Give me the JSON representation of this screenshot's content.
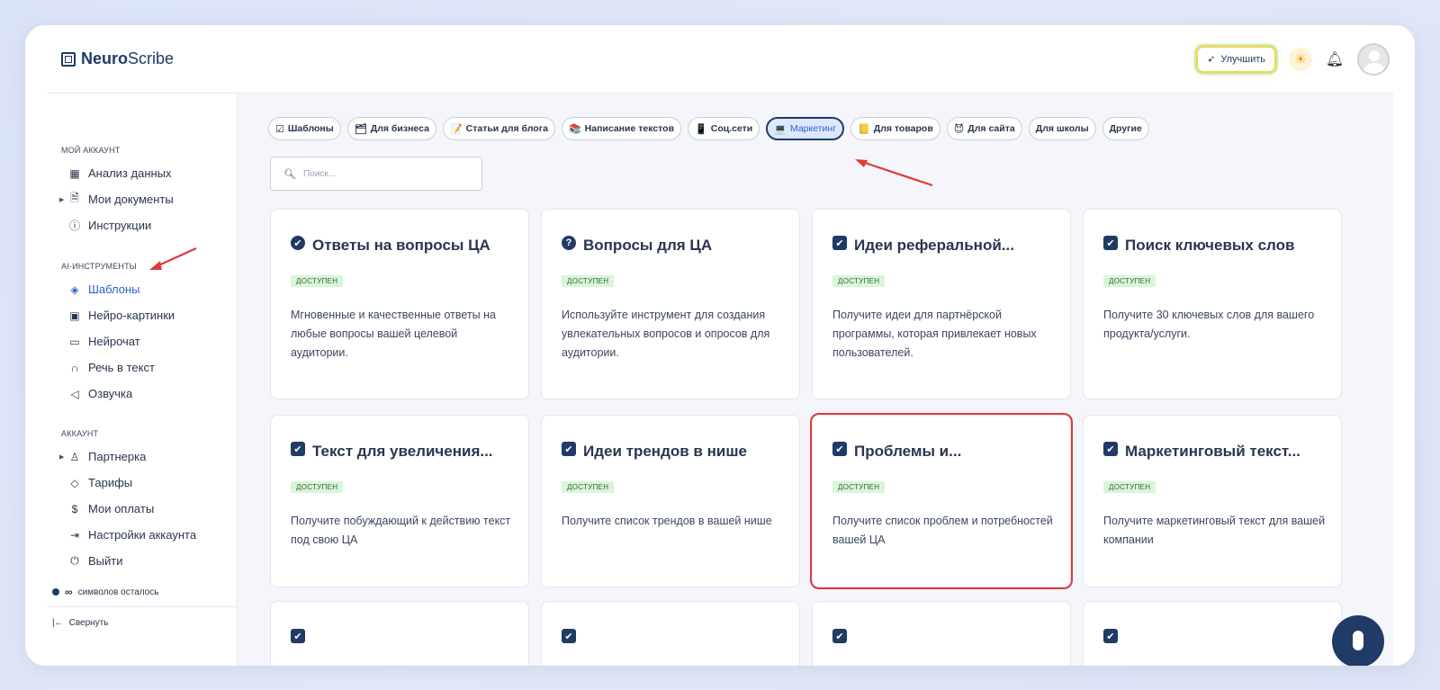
{
  "app": {
    "logo_bold": "Neuro",
    "logo_rest": "Scribe"
  },
  "header": {
    "upgrade_label": "Улучшить"
  },
  "sidebar": {
    "sections": [
      {
        "title": "МОЙ АККАУНТ",
        "items": [
          {
            "label": "Анализ данных",
            "icon": "grid-icon"
          },
          {
            "label": "Мои документы",
            "icon": "document-icon",
            "caret": true
          },
          {
            "label": "Инструкции",
            "icon": "help-circle-icon"
          }
        ]
      },
      {
        "title": "AI-ИНСТРУМЕНТЫ",
        "items": [
          {
            "label": "Шаблоны",
            "icon": "layers-icon",
            "active": true
          },
          {
            "label": "Нейро-картинки",
            "icon": "image-icon"
          },
          {
            "label": "Нейрочат",
            "icon": "chat-icon"
          },
          {
            "label": "Речь в текст",
            "icon": "headphones-icon"
          },
          {
            "label": "Озвучка",
            "icon": "speaker-icon"
          }
        ]
      },
      {
        "title": "АККАУНТ",
        "items": [
          {
            "label": "Партнерка",
            "icon": "users-icon",
            "caret": true
          },
          {
            "label": "Тарифы",
            "icon": "tag-icon"
          },
          {
            "label": "Мои оплаты",
            "icon": "dollar-icon"
          },
          {
            "label": "Настройки аккаунта",
            "icon": "login-icon"
          },
          {
            "label": "Выйти",
            "icon": "power-icon"
          }
        ]
      }
    ],
    "credits_value": "∞",
    "credits_label": "символов осталось",
    "collapse_label": "Свернуть"
  },
  "filters": [
    {
      "label": "Шаблоны",
      "icon": "☑"
    },
    {
      "label": "Для бизнеса",
      "icon": "🗂"
    },
    {
      "label": "Статьи для блога",
      "icon": "📝"
    },
    {
      "label": "Написание текстов",
      "icon": "📚"
    },
    {
      "label": "Соц.сети",
      "icon": "📱"
    },
    {
      "label": "Маркетинг",
      "icon": "💻",
      "active": true
    },
    {
      "label": "Для товаров",
      "icon": "📒"
    },
    {
      "label": "Для сайта",
      "icon": "😈"
    },
    {
      "label": "Для школы",
      "icon": ""
    },
    {
      "label": "Другие",
      "icon": ""
    }
  ],
  "search": {
    "placeholder": "Поиск..."
  },
  "cards": [
    {
      "title": "Ответы на вопросы ЦА",
      "badge": "ДОСТУПЕН",
      "desc": "Мгновенные и качественные ответы на любые вопросы вашей целевой аудитории.",
      "icon": "✔",
      "round": true
    },
    {
      "title": "Вопросы для ЦА",
      "badge": "ДОСТУПЕН",
      "desc": "Используйте инструмент для создания увлекательных вопросов и опросов для аудитории.",
      "icon": "?",
      "round": true
    },
    {
      "title": "Идеи реферальной...",
      "badge": "ДОСТУПЕН",
      "desc": "Получите идеи для партнёрской программы, которая привлекает новых пользователей.",
      "icon": "✔"
    },
    {
      "title": "Поиск ключевых слов",
      "badge": "ДОСТУПЕН",
      "desc": "Получите 30 ключевых слов для вашего продукта/услуги.",
      "icon": "✔"
    },
    {
      "title": "Текст для увеличения...",
      "badge": "ДОСТУПЕН",
      "desc": "Получите побуждающий к действию текст под свою ЦА",
      "icon": "✔"
    },
    {
      "title": "Идеи трендов в нише",
      "badge": "ДОСТУПЕН",
      "desc": "Получите список трендов в вашей нише",
      "icon": "✔"
    },
    {
      "title": "Проблемы и...",
      "badge": "ДОСТУПЕН",
      "desc": "Получите список проблем и потребностей вашей ЦА",
      "icon": "✔",
      "highlight": true
    },
    {
      "title": "Маркетинговый текст...",
      "badge": "ДОСТУПЕН",
      "desc": "Получите маркетинговый текст для вашей компании",
      "icon": "✔"
    }
  ]
}
